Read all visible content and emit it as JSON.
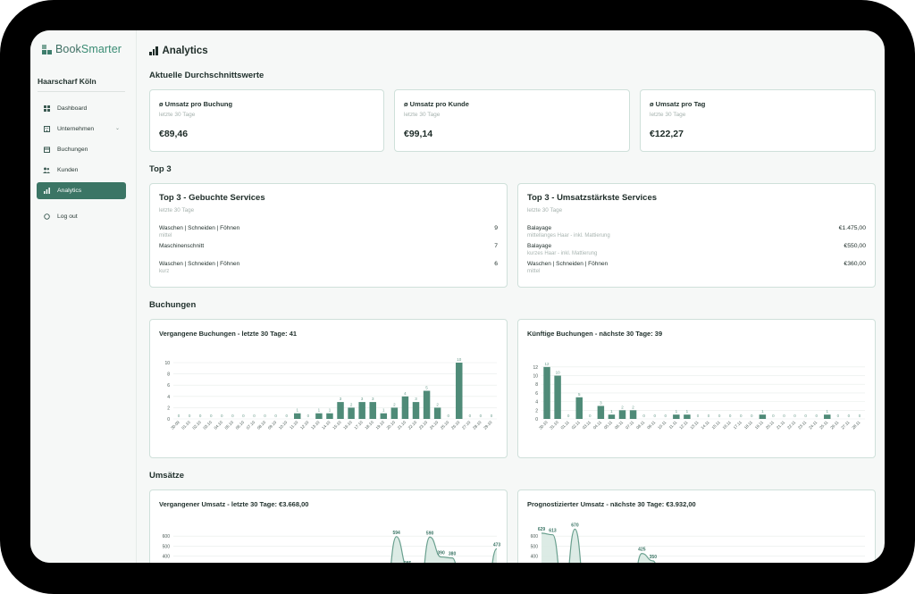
{
  "app": {
    "logo_part1": "Book",
    "logo_part2": "Smarter",
    "company": "Haarscharf Köln"
  },
  "sidebar": {
    "items": [
      {
        "label": "Dashboard",
        "icon": "grid-icon"
      },
      {
        "label": "Unternehmen",
        "icon": "building-icon"
      },
      {
        "label": "Buchungen",
        "icon": "calendar-icon"
      },
      {
        "label": "Kunden",
        "icon": "users-icon"
      },
      {
        "label": "Analytics",
        "icon": "bar-chart-icon",
        "active": true
      }
    ],
    "logout": "Log out"
  },
  "page": {
    "title": "Analytics",
    "sections": {
      "averages": "Aktuelle Durchschnittswerte",
      "top3": "Top 3",
      "bookings": "Buchungen",
      "revenue": "Umsätze"
    }
  },
  "kpis": [
    {
      "title": "ø Umsatz pro Buchung",
      "sub": "letzte 30 Tage",
      "value": "€89,46"
    },
    {
      "title": "ø Umsatz pro Kunde",
      "sub": "letzte 30 Tage",
      "value": "€99,14"
    },
    {
      "title": "ø Umsatz pro Tag",
      "sub": "letzte 30 Tage",
      "value": "€122,27"
    }
  ],
  "top_booked": {
    "title": "Top 3 - Gebuchte Services",
    "sub": "letzte 30 Tage",
    "rows": [
      {
        "name": "Waschen | Schneiden | Föhnen",
        "sub": "mittel",
        "value": "9"
      },
      {
        "name": "Maschinenschnitt",
        "sub": "",
        "value": "7"
      },
      {
        "name": "Waschen | Schneiden | Föhnen",
        "sub": "kurz",
        "value": "6"
      }
    ]
  },
  "top_revenue": {
    "title": "Top 3 - Umsatzstärkste Services",
    "sub": "letzte 30 Tage",
    "rows": [
      {
        "name": "Balayage",
        "sub": "mittellanges Haar - inkl. Mattierung",
        "value": "€1.475,00"
      },
      {
        "name": "Balayage",
        "sub": "kurzes Haar - inkl. Mattierung",
        "value": "€550,00"
      },
      {
        "name": "Waschen | Schneiden | Föhnen",
        "sub": "mittel",
        "value": "€360,00"
      }
    ]
  },
  "chart_titles": {
    "past_bookings": "Vergangene Buchungen - letzte 30 Tage: 41",
    "future_bookings": "Künftige Buchungen - nächste 30 Tage: 39",
    "past_revenue": "Vergangener Umsatz - letzte 30 Tage: €3.668,00",
    "future_revenue": "Prognostizierter Umsatz - nächste 30 Tage: €3.932,00"
  },
  "colors": {
    "accent": "#3b7565",
    "bar": "#4f8b78",
    "area_fill": "#d6e8e1",
    "area_line": "#6aa08f"
  },
  "chart_data": [
    {
      "type": "bar",
      "title": "Vergangene Buchungen - letzte 30 Tage: 41",
      "categories": [
        "30.09",
        "01.10",
        "02.10",
        "03.10",
        "04.10",
        "05.10",
        "06.10",
        "07.10",
        "08.10",
        "09.10",
        "10.10",
        "11.10",
        "12.10",
        "13.10",
        "14.10",
        "15.10",
        "16.10",
        "17.10",
        "18.10",
        "19.10",
        "20.10",
        "21.10",
        "22.10",
        "23.10",
        "24.10",
        "25.10",
        "26.10",
        "27.10",
        "28.10",
        "29.10"
      ],
      "values": [
        0,
        0,
        0,
        0,
        0,
        0,
        0,
        0,
        0,
        0,
        0,
        1,
        0,
        1,
        1,
        3,
        2,
        3,
        3,
        1,
        2,
        4,
        3,
        5,
        2,
        0,
        10,
        0,
        0,
        0
      ],
      "yticks": [
        0,
        2,
        4,
        6,
        8,
        10
      ],
      "ylim": [
        0,
        10
      ]
    },
    {
      "type": "bar",
      "title": "Künftige Buchungen - nächste 30 Tage: 39",
      "categories": [
        "30.10",
        "31.10",
        "01.11",
        "02.11",
        "03.11",
        "04.11",
        "05.11",
        "06.11",
        "07.11",
        "08.11",
        "09.11",
        "10.11",
        "11.11",
        "12.11",
        "13.11",
        "14.11",
        "15.11",
        "16.11",
        "17.11",
        "18.11",
        "19.11",
        "20.11",
        "21.11",
        "22.11",
        "23.11",
        "24.11",
        "25.11",
        "26.11",
        "27.11",
        "28.11"
      ],
      "values": [
        12,
        10,
        0,
        5,
        0,
        3,
        1,
        2,
        2,
        0,
        0,
        0,
        1,
        1,
        0,
        0,
        0,
        0,
        0,
        0,
        1,
        0,
        0,
        0,
        0,
        0,
        1,
        0,
        0,
        0
      ],
      "yticks": [
        0,
        2,
        4,
        6,
        8,
        10,
        12
      ],
      "ylim": [
        0,
        13
      ]
    },
    {
      "type": "area",
      "title": "Vergangener Umsatz - letzte 30 Tage: €3.668,00",
      "x": [
        0,
        1,
        2,
        3,
        4,
        5,
        6,
        7,
        8,
        9,
        10,
        11,
        12,
        13,
        14,
        15,
        16,
        17,
        18,
        19,
        20,
        21,
        22,
        23,
        24,
        25,
        26,
        27,
        28,
        29
      ],
      "values": [
        0,
        0,
        0,
        0,
        0,
        0,
        0,
        0,
        0,
        0,
        0,
        0,
        0,
        0,
        0,
        0,
        0,
        0,
        0,
        0,
        594,
        285,
        0,
        590,
        390,
        380,
        0,
        0,
        0,
        473
      ],
      "labels_shown": [
        "594",
        "285",
        "590",
        "390",
        "380",
        "473"
      ],
      "yticks": [
        300,
        400,
        500,
        600
      ],
      "ylim": [
        0,
        700
      ]
    },
    {
      "type": "area",
      "title": "Prognostizierter Umsatz - nächste 30 Tage: €3.932,00",
      "x": [
        0,
        1,
        2,
        3,
        4,
        5,
        6,
        7,
        8,
        9,
        10,
        11,
        12,
        13,
        14,
        15,
        16,
        17,
        18,
        19,
        20,
        21,
        22,
        23,
        24,
        25,
        26,
        27,
        28,
        29
      ],
      "values": [
        629,
        613,
        0,
        670,
        0,
        0,
        0,
        0,
        0,
        425,
        350,
        0,
        0,
        0,
        0,
        0,
        0,
        0,
        0,
        0,
        0,
        0,
        0,
        0,
        0,
        0,
        0,
        0,
        0,
        0
      ],
      "labels_shown": [
        "629",
        "613",
        "670",
        "425",
        "350"
      ],
      "yticks": [
        400,
        500,
        600
      ],
      "ylim": [
        0,
        700
      ]
    }
  ]
}
